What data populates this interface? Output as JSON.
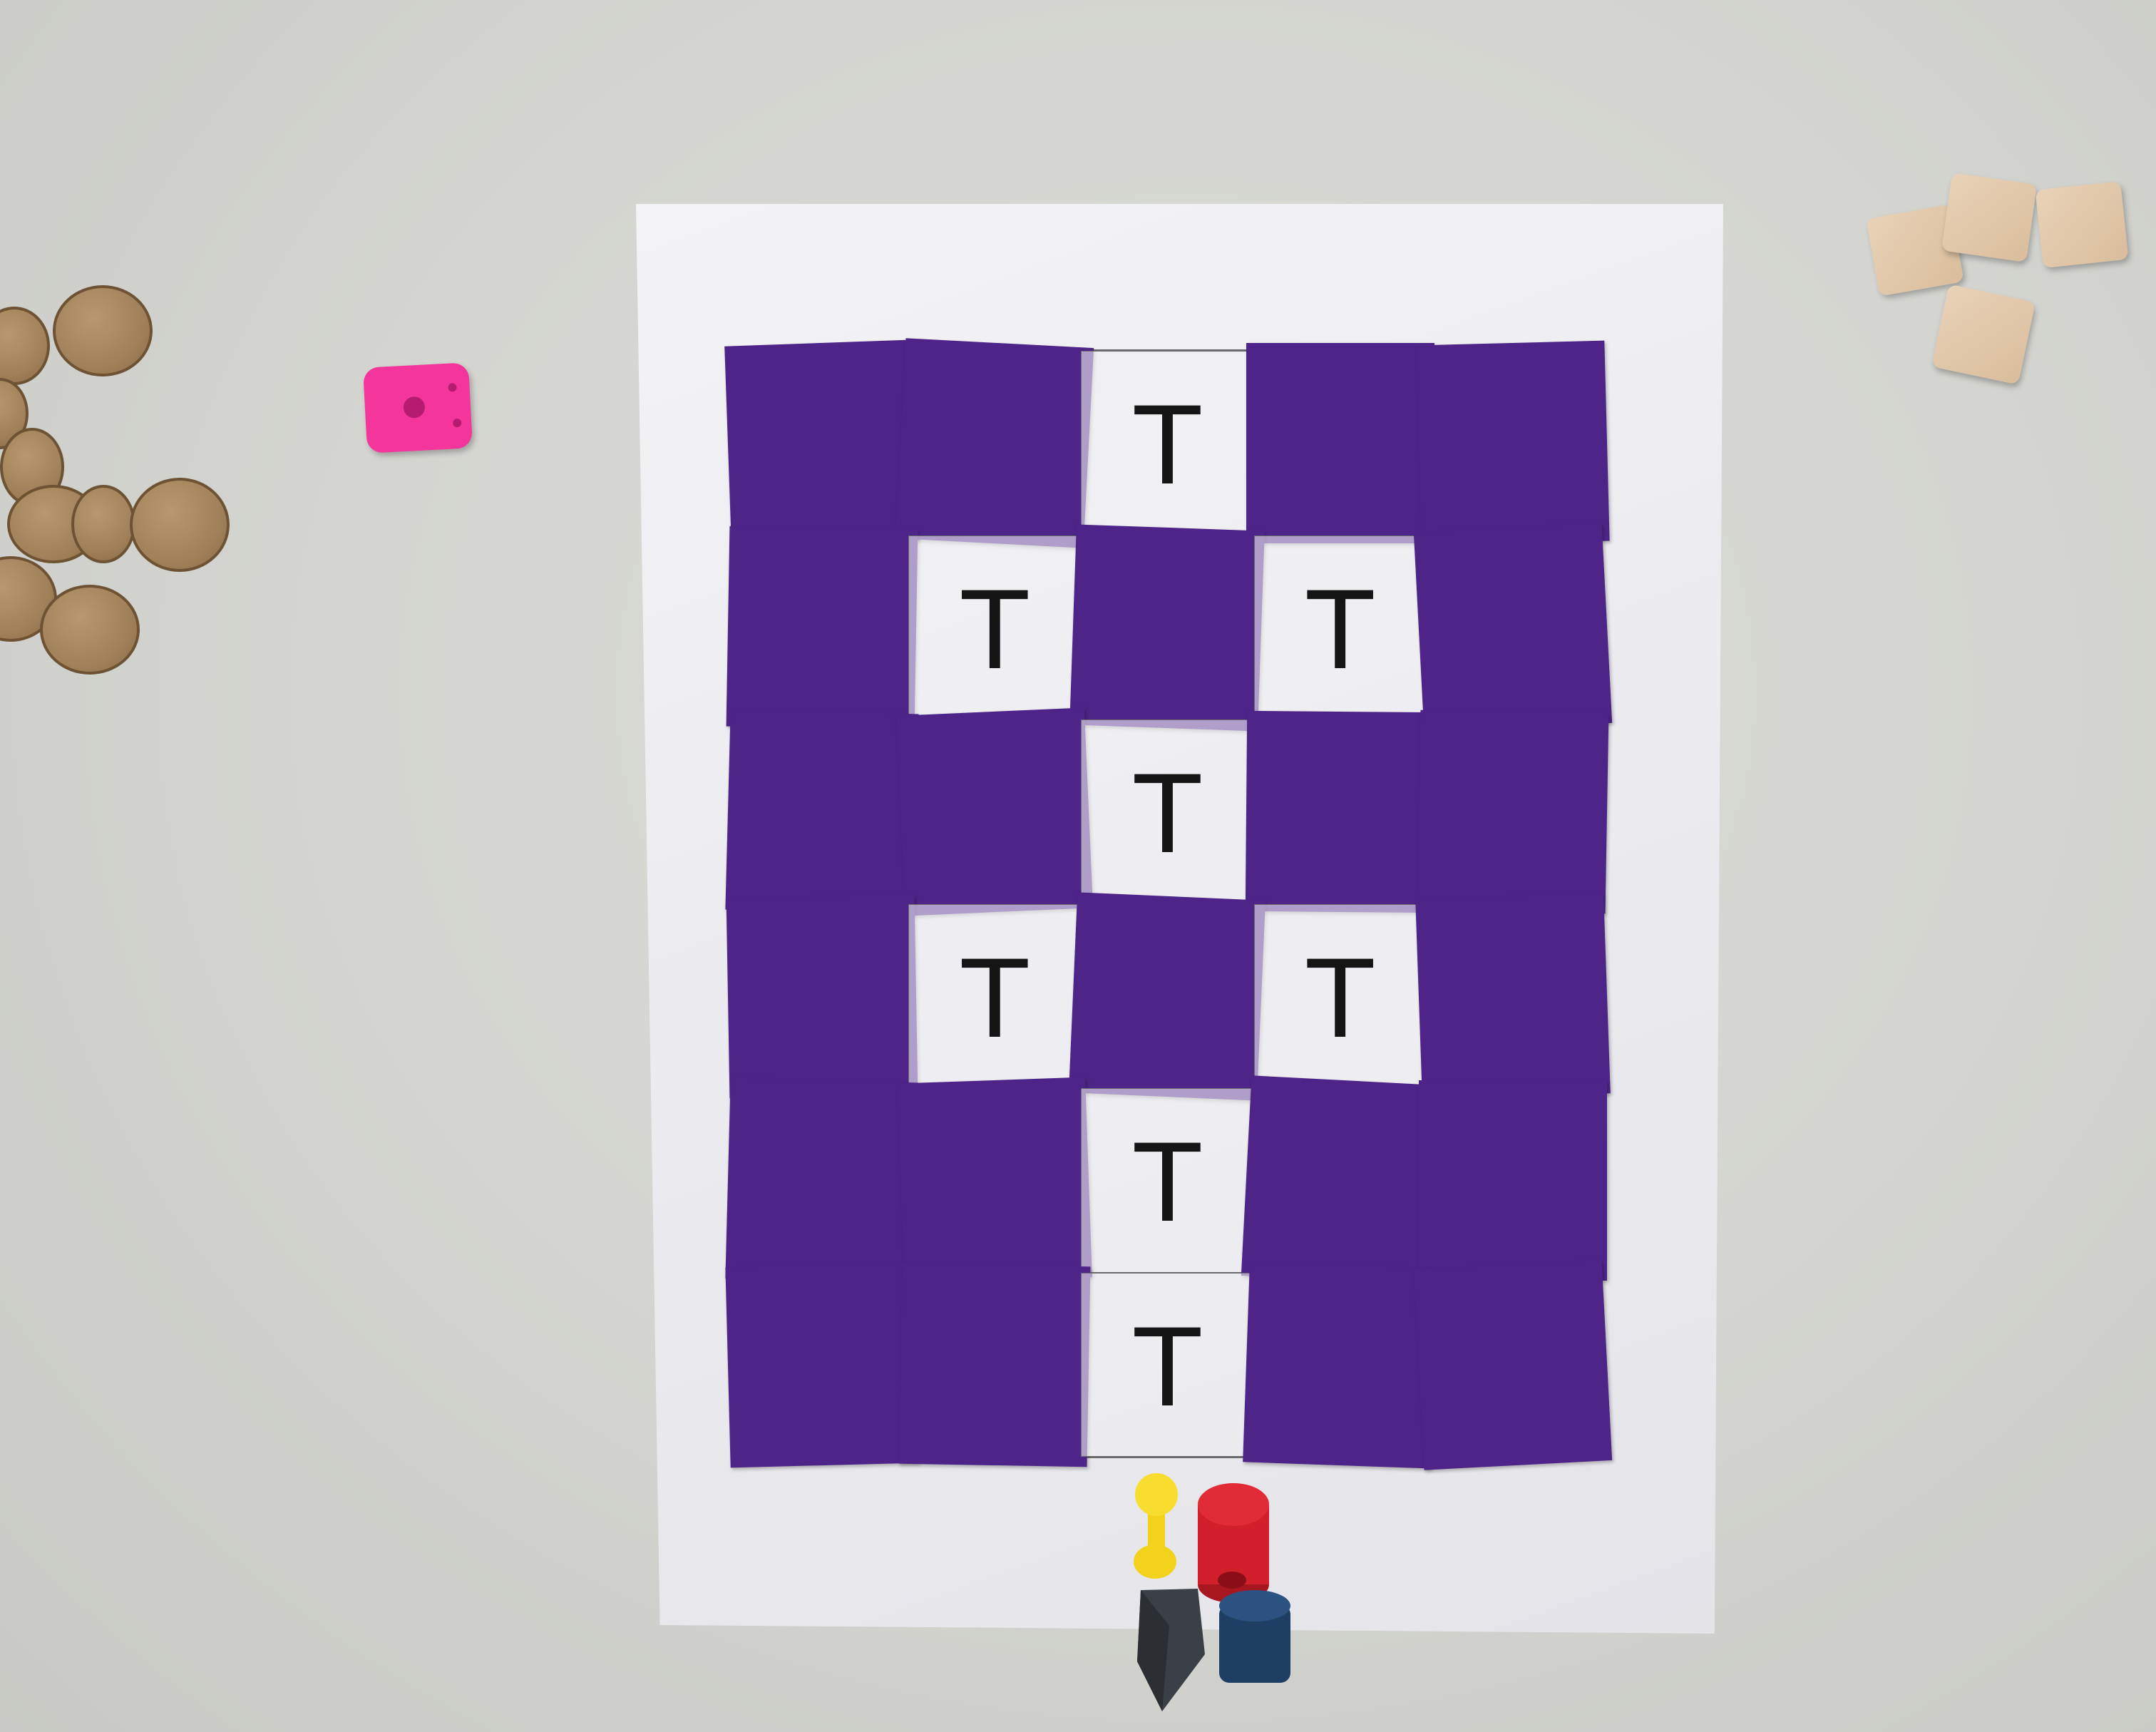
{
  "board": {
    "rows": [
      [
        "card",
        "card",
        "T",
        "card",
        "card"
      ],
      [
        "card",
        "T",
        "card",
        "T",
        "card"
      ],
      [
        "card",
        "card",
        "T",
        "card",
        "card"
      ],
      [
        "card",
        "T",
        "card",
        "T",
        "card"
      ],
      [
        "card",
        "card",
        "T",
        "card",
        "card"
      ],
      [
        "card",
        "card",
        "T",
        "card",
        "card"
      ]
    ],
    "card_color": "#4f2489"
  },
  "pieces": {
    "die_color": "#f4359c",
    "pawn_colors": [
      "#f2d21a",
      "#d21f2c",
      "#3b3f46",
      "#1f3e63"
    ],
    "disc_color": "#a2825a",
    "block_color": "#e2c8a8"
  }
}
